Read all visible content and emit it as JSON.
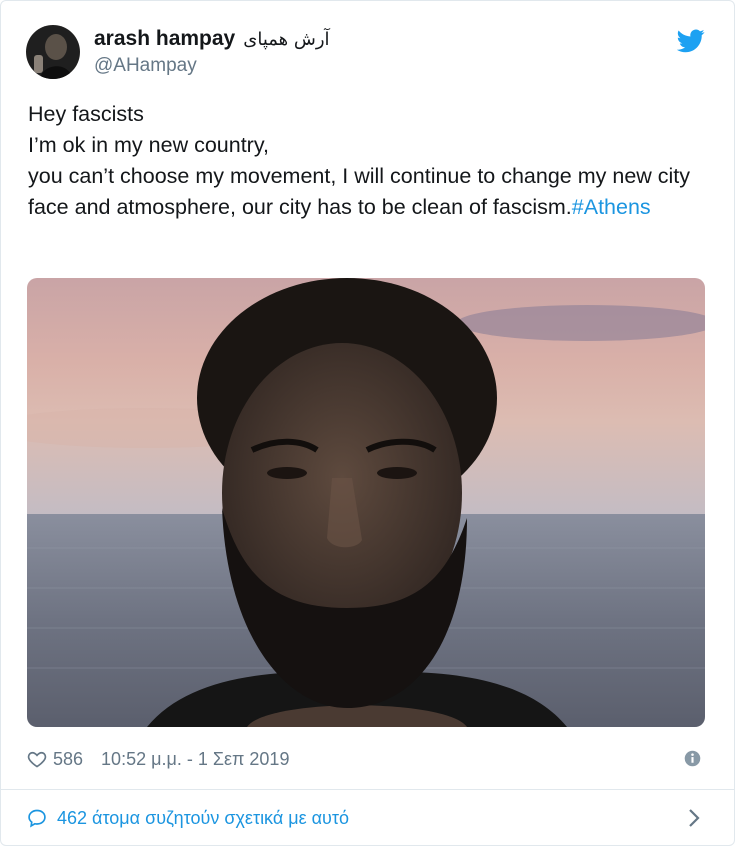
{
  "user": {
    "display_name": "arash hampay",
    "rtl_name": "آرش همپای",
    "handle": "@AHampay"
  },
  "tweet": {
    "lines": [
      "Hey fascists",
      "I’m ok in my new country,",
      "you can’t choose my movement, I will continue to change my new city face and atmosphere, our city has to be clean of fascism."
    ],
    "hashtag": "#Athens"
  },
  "meta": {
    "likes": "586",
    "timestamp": "10:52 μ.μ. - 1 Σεπ 2019"
  },
  "discussion": {
    "label": "462 άτομα συζητούν σχετικά με αυτό"
  },
  "icons": {
    "brand": "twitter-bird-icon",
    "like": "heart-icon",
    "info": "info-icon",
    "discuss": "speech-bubble-icon",
    "more": "chevron-right-icon"
  },
  "colors": {
    "accent": "#1b95e0",
    "muted": "#657786",
    "text": "#14171a",
    "border": "#e1e8ed"
  }
}
